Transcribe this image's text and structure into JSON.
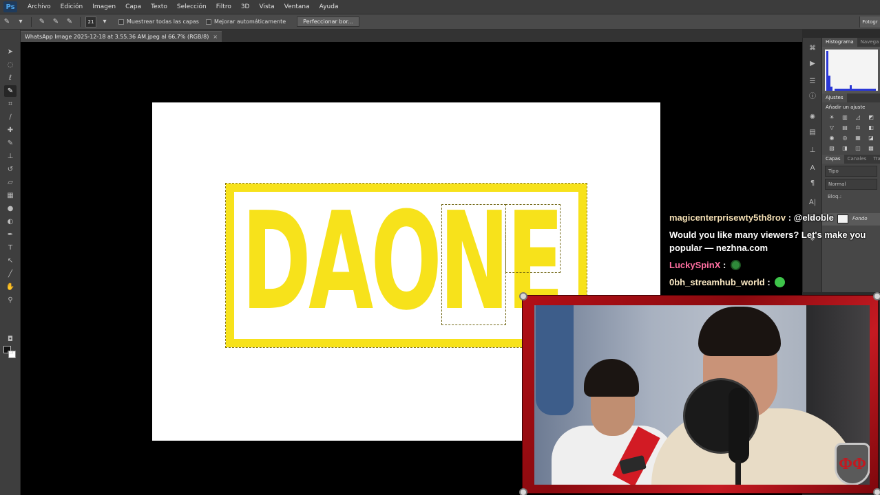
{
  "app": {
    "logo": "Ps",
    "menu": [
      "Archivo",
      "Edición",
      "Imagen",
      "Capa",
      "Texto",
      "Selección",
      "Filtro",
      "3D",
      "Vista",
      "Ventana",
      "Ayuda"
    ],
    "workspace_button": "Fotogr"
  },
  "options_bar": {
    "brush_size": "21",
    "sample_all_layers_label": "Muestrear todas las capas",
    "auto_enhance_label": "Mejorar automáticamente",
    "refine_edge_label": "Perfeccionar bor..."
  },
  "document": {
    "tab_title": "WhatsApp Image 2025-12-18 at 3.55.36 AM.jpeg al 66,7% (RGB/8)",
    "tab_close": "×",
    "logo_text": "DAONE",
    "logo_color": "#f7e21b"
  },
  "panels": {
    "histogram_tab": "Histograma",
    "navigator_tab": "Navega",
    "adjustments_tab": "Ajustes",
    "add_adjustment_label": "Añadir un ajuste",
    "layers_tab": "Capas",
    "channels_tab": "Canales",
    "paths_tab": "Traz",
    "kind_filter": "Tipo",
    "blend_mode": "Normal",
    "lock_label": "Bloq.:",
    "layer_name": "Fondo"
  },
  "chat": {
    "messages": [
      {
        "user": "magicenterprisewty5th8rov",
        "text": "@eldoble"
      },
      {
        "user": "",
        "text": "Would you like many viewers? Let's make you popular — nezhna.com"
      },
      {
        "user": "LuckySpinX",
        "text": ""
      },
      {
        "user": "0bh_streamhub_world",
        "text": ""
      }
    ]
  },
  "webcam": {
    "emblem_text": "ΦΦ",
    "frame_color": "#b30f16"
  }
}
